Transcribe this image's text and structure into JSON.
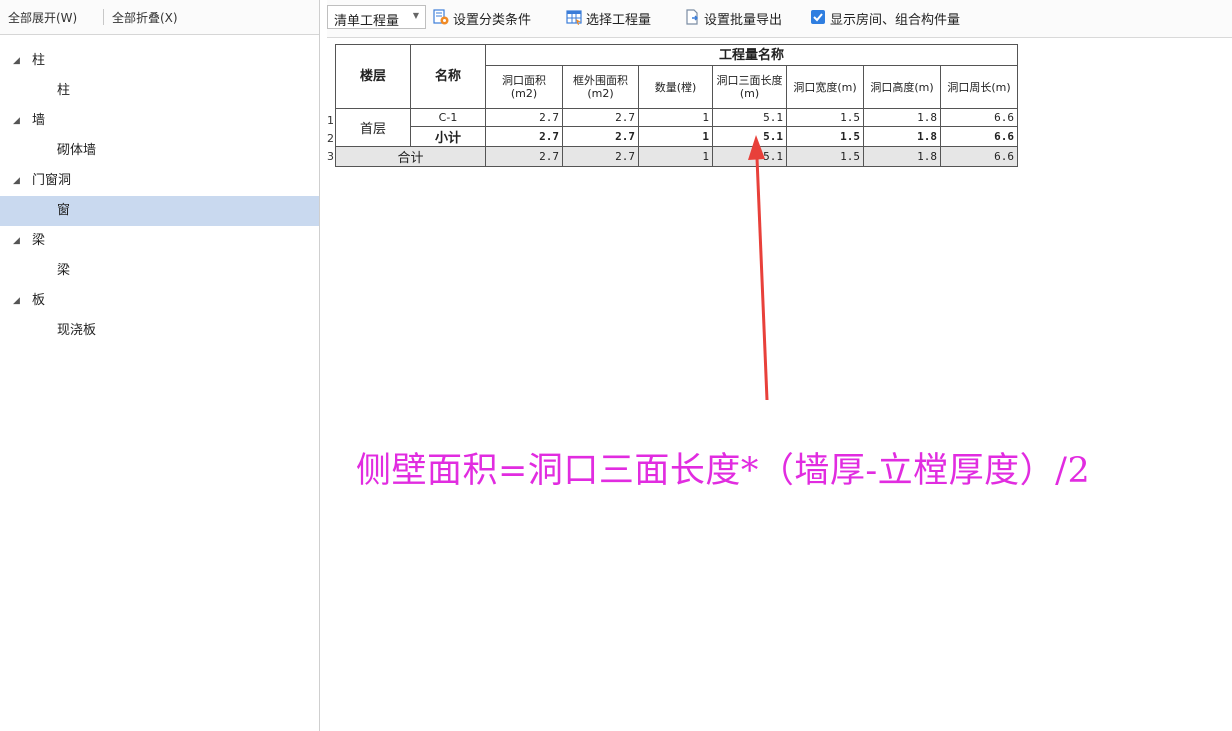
{
  "left_panel": {
    "expand_all": "全部展开(W)",
    "collapse_all": "全部折叠(X)",
    "tree": [
      {
        "type": "parent",
        "label": "柱"
      },
      {
        "type": "child",
        "label": "柱"
      },
      {
        "type": "parent",
        "label": "墙"
      },
      {
        "type": "child",
        "label": "砌体墙"
      },
      {
        "type": "parent",
        "label": "门窗洞"
      },
      {
        "type": "child",
        "label": "窗",
        "selected": true
      },
      {
        "type": "parent",
        "label": "梁"
      },
      {
        "type": "child",
        "label": "梁"
      },
      {
        "type": "parent",
        "label": "板"
      },
      {
        "type": "child",
        "label": "现浇板"
      }
    ]
  },
  "toolbar": {
    "dropdown_value": "清单工程量",
    "set_category": "设置分类条件",
    "select_quantity": "选择工程量",
    "batch_export": "设置批量导出",
    "show_rooms": "显示房间、组合构件量",
    "show_rooms_checked": true
  },
  "table": {
    "header_floor": "楼层",
    "header_name": "名称",
    "header_group": "工程量名称",
    "columns": [
      "洞口面积(m2)",
      "框外围面积(m2)",
      "数量(樘)",
      "洞口三面长度(m)",
      "洞口宽度(m)",
      "洞口高度(m)",
      "洞口周长(m)"
    ],
    "row_numbers": [
      "1",
      "2",
      "3"
    ],
    "floor_value": "首层",
    "rows": [
      {
        "name": "C-1",
        "values": [
          "2.7",
          "2.7",
          "1",
          "5.1",
          "1.5",
          "1.8",
          "6.6"
        ]
      },
      {
        "name": "小计",
        "values": [
          "2.7",
          "2.7",
          "1",
          "5.1",
          "1.5",
          "1.8",
          "6.6"
        ]
      }
    ],
    "total_label": "合计",
    "total_values": [
      "2.7",
      "2.7",
      "1",
      "5.1",
      "1.5",
      "1.8",
      "6.6"
    ]
  },
  "annotation": {
    "text": "侧壁面积=洞口三面长度*（墙厚-立樘厚度）/2",
    "color": "#e12ce0",
    "arrow_color": "#e8403a"
  }
}
